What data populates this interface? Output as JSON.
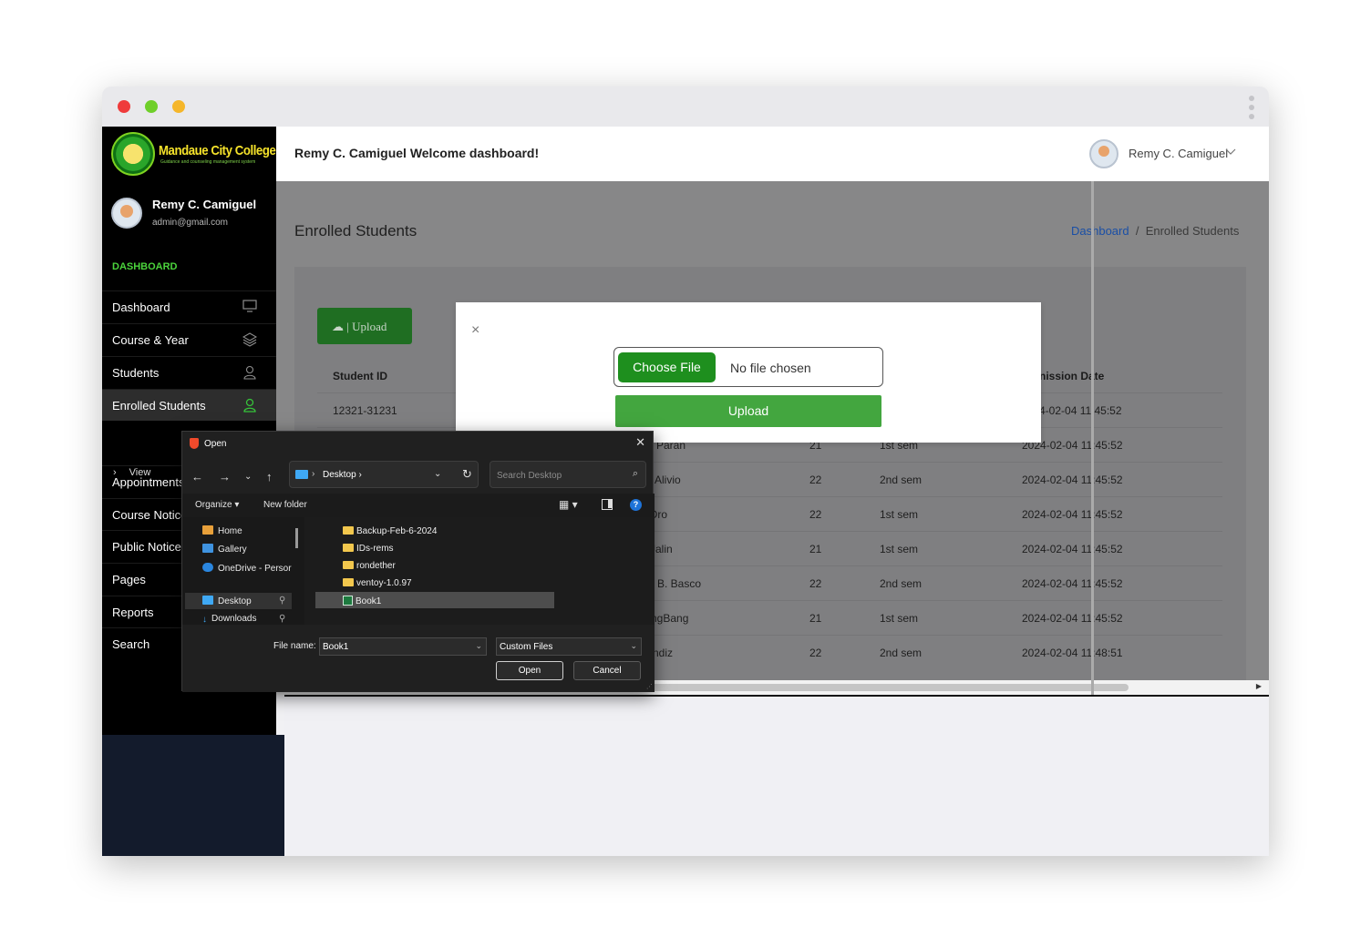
{
  "window": {
    "dot_colors": [
      "#ef3b3b",
      "#6fcf2a",
      "#f5b62a"
    ]
  },
  "sidebar": {
    "logo_text": "Mandaue City College",
    "logo_subtext": "Guidance and counseling management system",
    "user_name": "Remy C. Camiguel",
    "user_email": "admin@gmail.com",
    "heading": "DASHBOARD",
    "items": [
      {
        "label": "Dashboard",
        "icon": "monitor-icon"
      },
      {
        "label": "Course & Year",
        "icon": "layers-icon"
      },
      {
        "label": "Students",
        "icon": "user-icon"
      },
      {
        "label": "Enrolled Students",
        "icon": "user-icon",
        "active": true
      },
      {
        "label": "Appointments"
      },
      {
        "label": "Course Notice"
      },
      {
        "label": "Public Notice"
      },
      {
        "label": "Pages"
      },
      {
        "label": "Reports"
      },
      {
        "label": "Search"
      }
    ],
    "sub_item": "View"
  },
  "header": {
    "welcome": "Remy C. Camiguel Welcome dashboard!",
    "user_name": "Remy C. Camiguel"
  },
  "page": {
    "title": "Enrolled Students",
    "breadcrumb": {
      "link": "Dashboard",
      "separator": "/",
      "current": "Enrolled Students"
    },
    "upload_button": "| Upload"
  },
  "table": {
    "headers": [
      "Student ID",
      "nission Date"
    ],
    "rows": [
      {
        "id": "12321-31231",
        "name": "",
        "age": "",
        "sem": "",
        "date": "4-02-04 11:45:52"
      },
      {
        "id": "",
        "name": "Paran",
        "age": "21",
        "sem": "1st sem",
        "date": "2024-02-04 11:45:52"
      },
      {
        "id": "",
        "name": "Alivio",
        "age": "22",
        "sem": "2nd sem",
        "date": "2024-02-04 11:45:52"
      },
      {
        "id": "",
        "name": "Oro",
        "age": "22",
        "sem": "1st sem",
        "date": "2024-02-04 11:45:52"
      },
      {
        "id": "",
        "name": "Jalin",
        "age": "21",
        "sem": "1st sem",
        "date": "2024-02-04 11:45:52"
      },
      {
        "id": "",
        "name": "B. Basco",
        "age": "22",
        "sem": "2nd sem",
        "date": "2024-02-04 11:45:52"
      },
      {
        "id": "",
        "name": "ngBang",
        "age": "21",
        "sem": "1st sem",
        "date": "2024-02-04 11:45:52"
      },
      {
        "id": "",
        "name": "ndiz",
        "age": "22",
        "sem": "2nd sem",
        "date": "2024-02-04 11:48:51"
      }
    ]
  },
  "modal": {
    "close": "×",
    "choose_file": "Choose File",
    "no_file": "No file chosen",
    "upload": "Upload"
  },
  "open_dialog": {
    "title": "Open",
    "close": "✕",
    "address": "Desktop ›",
    "search_placeholder": "Search Desktop",
    "organize": "Organize ▾",
    "new_folder": "New folder",
    "nav_items": [
      "Home",
      "Gallery",
      "OneDrive - Persor",
      "Desktop",
      "Downloads"
    ],
    "files": [
      {
        "name": "Backup-Feb-6-2024",
        "type": "folder"
      },
      {
        "name": "IDs-rems",
        "type": "folder"
      },
      {
        "name": "rondether",
        "type": "folder"
      },
      {
        "name": "ventoy-1.0.97",
        "type": "folder"
      },
      {
        "name": "Book1",
        "type": "excel",
        "selected": true
      }
    ],
    "file_name_label": "File name:",
    "file_name_value": "Book1",
    "file_type": "Custom Files",
    "open_button": "Open",
    "cancel_button": "Cancel"
  }
}
